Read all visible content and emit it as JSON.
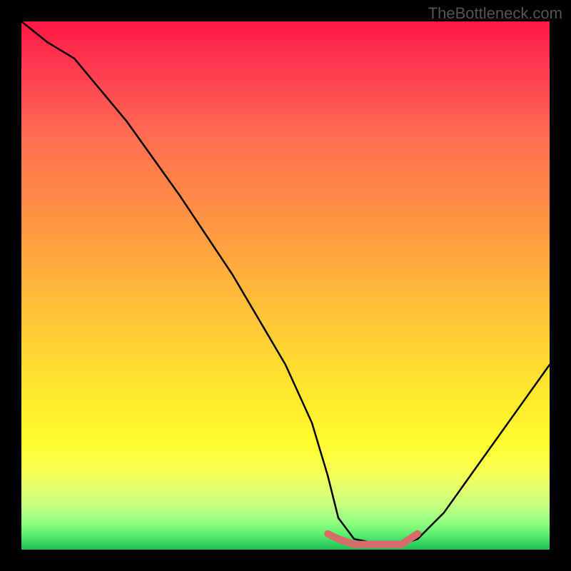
{
  "watermark": "TheBottleneck.com",
  "chart_data": {
    "type": "line",
    "title": "",
    "xlabel": "",
    "ylabel": "",
    "xlim": [
      0,
      100
    ],
    "ylim": [
      0,
      100
    ],
    "series": [
      {
        "name": "bottleneck-curve",
        "color": "#000000",
        "x": [
          0,
          5,
          10,
          20,
          30,
          40,
          50,
          55,
          58,
          60,
          63,
          68,
          70,
          72,
          75,
          80,
          85,
          90,
          95,
          100
        ],
        "values": [
          100,
          96,
          93,
          81,
          67,
          52,
          35,
          24,
          14,
          6,
          2,
          1,
          1,
          1,
          2,
          7,
          14,
          21,
          28,
          35
        ]
      },
      {
        "name": "optimal-range-highlight",
        "color": "#d86a6a",
        "x": [
          58,
          60,
          63,
          68,
          70,
          72,
          75
        ],
        "values": [
          3,
          2,
          1,
          1,
          1,
          1,
          3
        ]
      }
    ],
    "gradient_stops": [
      {
        "pos": 0,
        "color": "#ff1744"
      },
      {
        "pos": 50,
        "color": "#ffca36"
      },
      {
        "pos": 85,
        "color": "#f8ff50"
      },
      {
        "pos": 100,
        "color": "#20c050"
      }
    ]
  }
}
